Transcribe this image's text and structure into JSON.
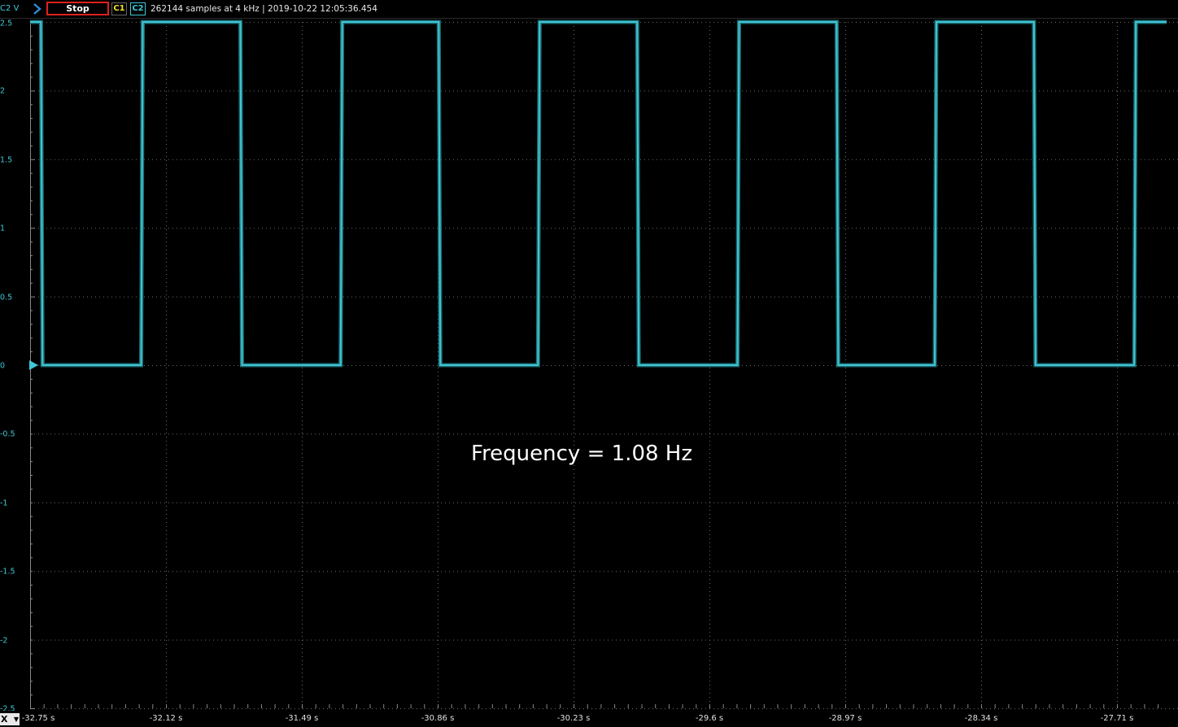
{
  "toolbar": {
    "y_unit_label": "C2 V",
    "stop_label": "Stop",
    "ch1_label": "C1",
    "ch2_label": "C2",
    "status": "262144 samples at 4 kHz | 2019-10-22 12:05:36.454"
  },
  "xaxis_menu_label": "X",
  "annotation": "Frequency = 1.08 Hz",
  "colors": {
    "trace": "#3ec7d6",
    "grid": "#6a6a6a",
    "stop_border": "#e02020",
    "ch1": "#f0e020"
  },
  "icons": {
    "run": "chevron-right-icon",
    "dropdown": "chevron-down-icon",
    "trigger_marker": "triangle-right-icon"
  },
  "chart_data": {
    "type": "line",
    "title": "",
    "xlabel": "",
    "ylabel": "C2 V",
    "x_ticks": [
      "-32.75 s",
      "-32.12 s",
      "-31.49 s",
      "-30.86 s",
      "-30.23 s",
      "-29.6 s",
      "-28.97 s",
      "-28.34 s",
      "-27.71 s"
    ],
    "y_ticks": [
      "2.5",
      "2",
      "1.5",
      "1",
      "0.5",
      "0",
      "-0.5",
      "-1",
      "-1.5",
      "-2",
      "-2.5"
    ],
    "xlim": [
      -32.75,
      -27.48
    ],
    "ylim": [
      -2.5,
      2.5
    ],
    "grid": true,
    "series": [
      {
        "name": "C2",
        "low": 0,
        "high": 2.5,
        "transitions": [
          {
            "t": -32.7,
            "to": 0
          },
          {
            "t": -32.235,
            "to": 2.5
          },
          {
            "t": -31.775,
            "to": 0
          },
          {
            "t": -31.31,
            "to": 2.5
          },
          {
            "t": -30.855,
            "to": 0
          },
          {
            "t": -30.395,
            "to": 2.5
          },
          {
            "t": -29.935,
            "to": 0
          },
          {
            "t": -29.47,
            "to": 2.5
          },
          {
            "t": -29.01,
            "to": 0
          },
          {
            "t": -28.555,
            "to": 2.5
          },
          {
            "t": -28.095,
            "to": 0
          },
          {
            "t": -27.63,
            "to": 2.5
          }
        ]
      }
    ]
  }
}
